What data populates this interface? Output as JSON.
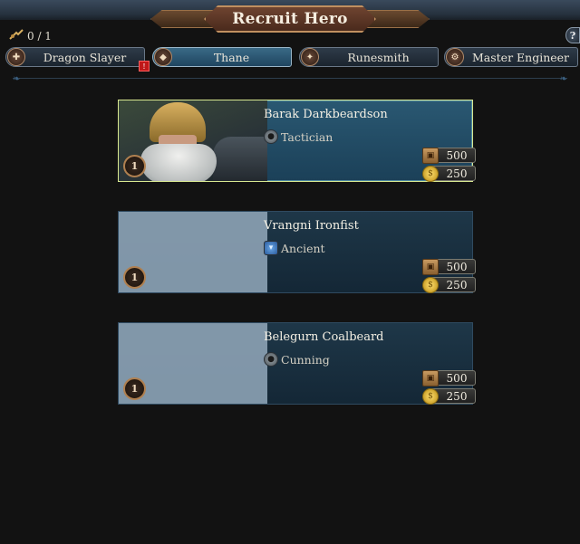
{
  "window": {
    "title": "Recruit Hero"
  },
  "counter": {
    "value": "0 / 1",
    "icon": "hero-cap-icon"
  },
  "help": {
    "label": "?"
  },
  "tabs": [
    {
      "label": "Dragon Slayer",
      "icon": "slayer-axe-icon",
      "active": false,
      "alert": true
    },
    {
      "label": "Thane",
      "icon": "thane-helm-icon",
      "active": true,
      "alert": false
    },
    {
      "label": "Runesmith",
      "icon": "rune-hammer-icon",
      "active": false,
      "alert": false
    },
    {
      "label": "Master Engineer",
      "icon": "engineer-gear-icon",
      "active": false,
      "alert": false
    }
  ],
  "heroes": [
    {
      "name": "Barak Darkbeardson",
      "trait": "Tactician",
      "trait_icon": "tactician-icon",
      "rank": "1",
      "cost_upkeep": "500",
      "cost_gold": "250",
      "selected": true,
      "has_portrait": true
    },
    {
      "name": "Vrangni Ironfist",
      "trait": "Ancient",
      "trait_icon": "ancient-icon",
      "rank": "1",
      "cost_upkeep": "500",
      "cost_gold": "250",
      "selected": false,
      "has_portrait": false
    },
    {
      "name": "Belegurn Coalbeard",
      "trait": "Cunning",
      "trait_icon": "cunning-icon",
      "rank": "1",
      "cost_upkeep": "500",
      "cost_gold": "250",
      "selected": false,
      "has_portrait": false
    }
  ],
  "colors": {
    "accent": "#d8e890",
    "panel": "#142736",
    "background": "#121212"
  }
}
